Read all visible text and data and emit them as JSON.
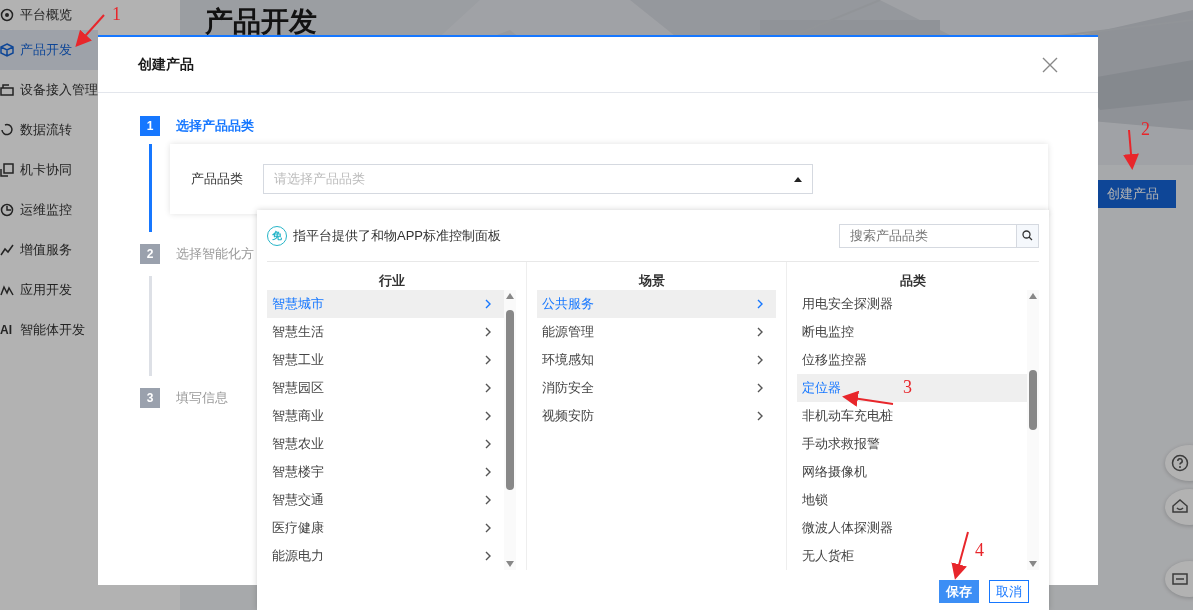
{
  "sidebar": {
    "items": [
      {
        "label": "平台概览",
        "selected": false
      },
      {
        "label": "产品开发",
        "selected": true
      },
      {
        "label": "设备接入管理",
        "selected": false
      },
      {
        "label": "数据流转",
        "selected": false
      },
      {
        "label": "机卡协同",
        "selected": false
      },
      {
        "label": "运维监控",
        "selected": false
      },
      {
        "label": "增值服务",
        "selected": false
      },
      {
        "label": "应用开发",
        "selected": false
      },
      {
        "label": "智能体开发",
        "selected": false,
        "icon_text": "AI"
      }
    ]
  },
  "page": {
    "title": "产品开发",
    "create_button": "创建产品"
  },
  "dialog": {
    "title": "创建产品",
    "steps": [
      {
        "number": "1",
        "label": "选择产品品类",
        "selected": true
      },
      {
        "number": "2",
        "label": "选择智能化方",
        "selected": false
      },
      {
        "number": "3",
        "label": "填写信息",
        "selected": false
      }
    ],
    "field": {
      "label": "产品品类",
      "placeholder": "请选择产品品类",
      "expanded": true
    }
  },
  "dropdown": {
    "badge": "免",
    "note": "指平台提供了和物APP标准控制面板",
    "search": {
      "placeholder": "搜索产品品类"
    },
    "columns": [
      {
        "title": "行业",
        "kind": "branch",
        "items": [
          {
            "label": "智慧城市",
            "selected": true
          },
          {
            "label": "智慧生活",
            "selected": false
          },
          {
            "label": "智慧工业",
            "selected": false
          },
          {
            "label": "智慧园区",
            "selected": false
          },
          {
            "label": "智慧商业",
            "selected": false
          },
          {
            "label": "智慧农业",
            "selected": false
          },
          {
            "label": "智慧楼宇",
            "selected": false
          },
          {
            "label": "智慧交通",
            "selected": false
          },
          {
            "label": "医疗健康",
            "selected": false
          },
          {
            "label": "能源电力",
            "selected": false
          }
        ]
      },
      {
        "title": "场景",
        "kind": "branch",
        "items": [
          {
            "label": "公共服务",
            "selected": true
          },
          {
            "label": "能源管理",
            "selected": false
          },
          {
            "label": "环境感知",
            "selected": false
          },
          {
            "label": "消防安全",
            "selected": false
          },
          {
            "label": "视频安防",
            "selected": false
          }
        ]
      },
      {
        "title": "品类",
        "kind": "leaf",
        "items": [
          {
            "label": "用电安全探测器",
            "selected": false
          },
          {
            "label": "断电监控",
            "selected": false
          },
          {
            "label": "位移监控器",
            "selected": false
          },
          {
            "label": "定位器",
            "selected": true
          },
          {
            "label": "非机动车充电桩",
            "selected": false
          },
          {
            "label": "手动求救报警",
            "selected": false
          },
          {
            "label": "网络摄像机",
            "selected": false
          },
          {
            "label": "地锁",
            "selected": false
          },
          {
            "label": "微波人体探测器",
            "selected": false
          },
          {
            "label": "无人货柜",
            "selected": false
          }
        ]
      }
    ],
    "buttons": [
      {
        "label": "保存",
        "kind": "primary"
      },
      {
        "label": "取消",
        "kind": "outline"
      }
    ]
  },
  "annotations": [
    {
      "label": "1"
    },
    {
      "label": "2"
    },
    {
      "label": "3"
    },
    {
      "label": "4"
    }
  ]
}
